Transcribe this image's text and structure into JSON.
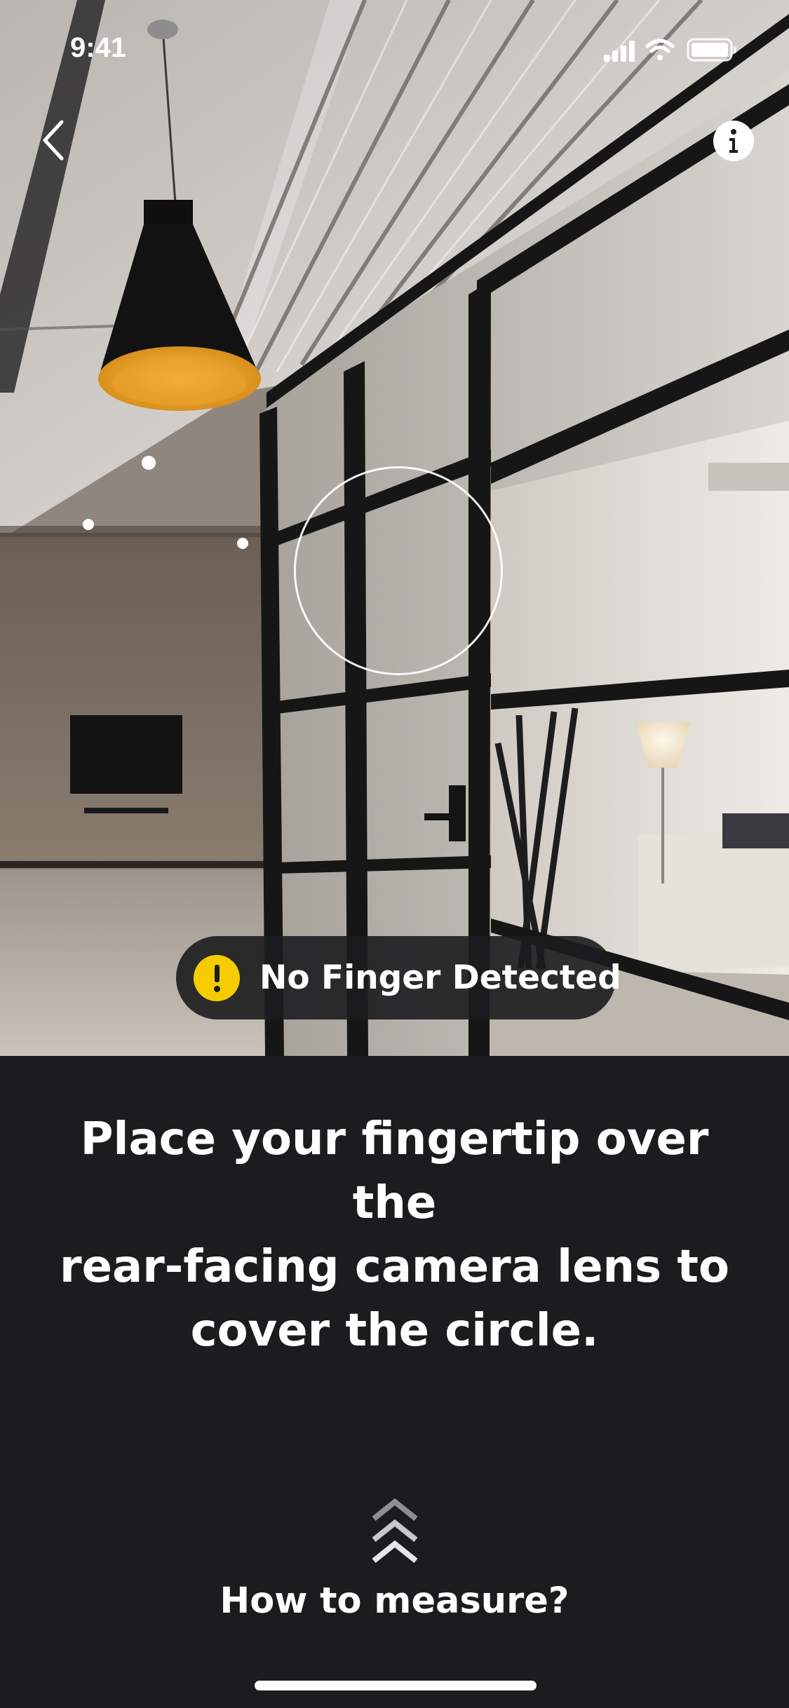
{
  "status_bar": {
    "time": "9:41",
    "icons": [
      "cellular-signal-icon",
      "wifi-icon",
      "battery-icon"
    ]
  },
  "nav": {
    "back_icon": "chevron-left-icon",
    "info_icon": "info-icon"
  },
  "camera": {
    "detection_status": "No Finger Detected",
    "detection_icon": "warning-icon",
    "warning_color": "#f6cc00"
  },
  "instruction": {
    "line1": "Place your fingertip over the",
    "line2": "rear-facing camera lens to",
    "line3": "cover the circle."
  },
  "how_to": {
    "label": "How to measure?",
    "icon": "triple-chevron-up-icon"
  },
  "colors": {
    "background": "#1c1c1e",
    "text": "#ffffff"
  }
}
